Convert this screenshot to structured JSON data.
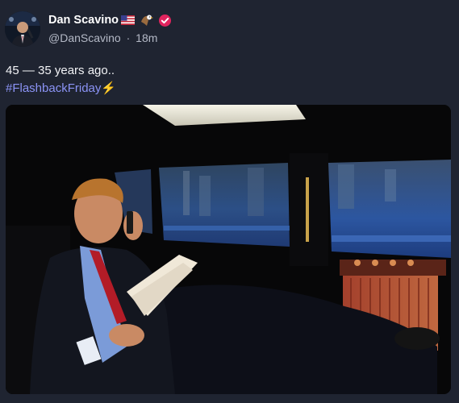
{
  "author": {
    "display_name": "Dan Scavino",
    "handle": "@DanScavino",
    "separator": "·",
    "timestamp": "18m",
    "name_emojis": [
      "us-flag-icon",
      "eagle-icon"
    ],
    "verified": true
  },
  "tweet": {
    "text": "45 — 35 years ago..",
    "hashtag": "#FlashbackFriday",
    "hashtag_emoji": "⚡"
  },
  "media": {
    "kind": "photo",
    "subject": "man in suit on phone reading papers in limousine"
  },
  "colors": {
    "background": "#1f2431",
    "hashtag": "#8b93f5",
    "verified_badge": "#e0245e",
    "muted_text": "#b4b9c6"
  }
}
